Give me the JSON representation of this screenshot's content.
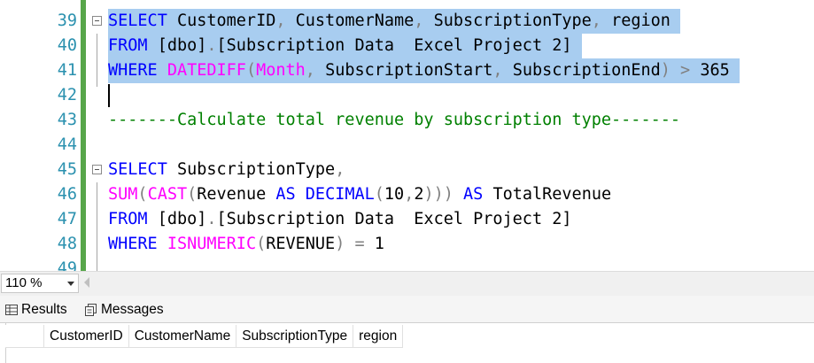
{
  "editor": {
    "lines": [
      {
        "num": "39",
        "selected": true,
        "fold": true,
        "parts": [
          {
            "t": "SELECT",
            "c": "kw"
          },
          {
            "t": " CustomerID",
            "c": "txt"
          },
          {
            "t": ",",
            "c": "op"
          },
          {
            "t": " CustomerName",
            "c": "txt"
          },
          {
            "t": ",",
            "c": "op"
          },
          {
            "t": " SubscriptionType",
            "c": "txt"
          },
          {
            "t": ",",
            "c": "op"
          },
          {
            "t": " region",
            "c": "txt"
          }
        ]
      },
      {
        "num": "40",
        "selected": true,
        "fold": false,
        "parts": [
          {
            "t": "FROM",
            "c": "kw"
          },
          {
            "t": " [dbo]",
            "c": "txt"
          },
          {
            "t": ".",
            "c": "op"
          },
          {
            "t": "[Subscription Data  Excel Project 2]",
            "c": "txt"
          }
        ]
      },
      {
        "num": "41",
        "selected": true,
        "fold": false,
        "parts": [
          {
            "t": "WHERE",
            "c": "kw"
          },
          {
            "t": " ",
            "c": "txt"
          },
          {
            "t": "DATEDIFF",
            "c": "fn"
          },
          {
            "t": "(",
            "c": "op"
          },
          {
            "t": "Month",
            "c": "fn"
          },
          {
            "t": ",",
            "c": "op"
          },
          {
            "t": " SubscriptionStart",
            "c": "txt"
          },
          {
            "t": ",",
            "c": "op"
          },
          {
            "t": " SubscriptionEnd",
            "c": "txt"
          },
          {
            "t": ")",
            "c": "op"
          },
          {
            "t": " > ",
            "c": "op"
          },
          {
            "t": "365",
            "c": "txt"
          }
        ]
      },
      {
        "num": "42",
        "selected": false,
        "fold": false,
        "parts": []
      },
      {
        "num": "43",
        "selected": false,
        "fold": false,
        "parts": [
          {
            "t": "-------Calculate total revenue by subscription type-------",
            "c": "cm"
          }
        ]
      },
      {
        "num": "44",
        "selected": false,
        "fold": false,
        "parts": []
      },
      {
        "num": "45",
        "selected": false,
        "fold": true,
        "parts": [
          {
            "t": "SELECT",
            "c": "kw"
          },
          {
            "t": " SubscriptionType",
            "c": "txt"
          },
          {
            "t": ",",
            "c": "op"
          }
        ]
      },
      {
        "num": "46",
        "selected": false,
        "fold": false,
        "parts": [
          {
            "t": "SUM",
            "c": "fn"
          },
          {
            "t": "(",
            "c": "op"
          },
          {
            "t": "CAST",
            "c": "fn"
          },
          {
            "t": "(",
            "c": "op"
          },
          {
            "t": "Revenue ",
            "c": "txt"
          },
          {
            "t": "AS",
            "c": "kw"
          },
          {
            "t": " ",
            "c": "txt"
          },
          {
            "t": "DECIMAL",
            "c": "kw"
          },
          {
            "t": "(",
            "c": "op"
          },
          {
            "t": "10",
            "c": "txt"
          },
          {
            "t": ",",
            "c": "op"
          },
          {
            "t": "2",
            "c": "txt"
          },
          {
            "t": ")))",
            "c": "op"
          },
          {
            "t": " ",
            "c": "txt"
          },
          {
            "t": "AS",
            "c": "kw"
          },
          {
            "t": " TotalRevenue",
            "c": "txt"
          }
        ]
      },
      {
        "num": "47",
        "selected": false,
        "fold": false,
        "parts": [
          {
            "t": "FROM",
            "c": "kw"
          },
          {
            "t": " [dbo]",
            "c": "txt"
          },
          {
            "t": ".",
            "c": "op"
          },
          {
            "t": "[Subscription Data  Excel Project 2]",
            "c": "txt"
          }
        ]
      },
      {
        "num": "48",
        "selected": false,
        "fold": false,
        "parts": [
          {
            "t": "WHERE",
            "c": "kw"
          },
          {
            "t": " ",
            "c": "txt"
          },
          {
            "t": "ISNUMERIC",
            "c": "fn"
          },
          {
            "t": "(",
            "c": "op"
          },
          {
            "t": "REVENUE",
            "c": "txt"
          },
          {
            "t": ")",
            "c": "op"
          },
          {
            "t": " = ",
            "c": "op"
          },
          {
            "t": "1",
            "c": "txt"
          }
        ]
      },
      {
        "num": "49",
        "selected": false,
        "fold": false,
        "parts": []
      }
    ],
    "colors": {
      "keyword": "#0000ff",
      "function": "#ff00ff",
      "comment": "#008000",
      "line_number": "#2b91af",
      "selection": "#a8cdf0",
      "change_bar": "#57a64a"
    }
  },
  "zoom": {
    "value": "110 %"
  },
  "results": {
    "tabs": [
      {
        "label": "Results",
        "icon": "grid-icon"
      },
      {
        "label": "Messages",
        "icon": "messages-icon"
      }
    ],
    "columns": [
      "CustomerID",
      "CustomerName",
      "SubscriptionType",
      "region"
    ]
  }
}
